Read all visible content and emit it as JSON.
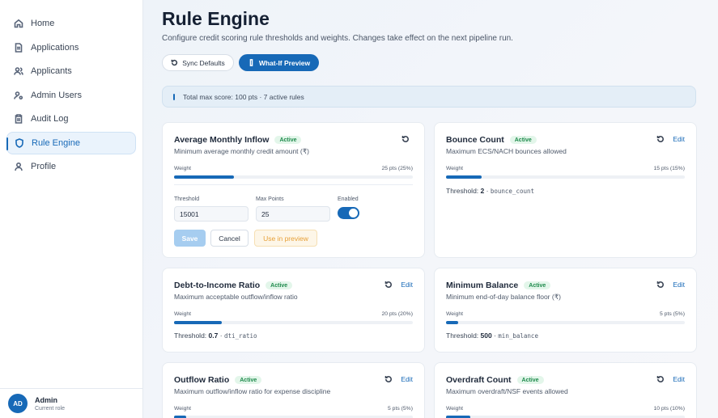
{
  "sidebar": {
    "items": [
      {
        "label": "Home",
        "icon": "home-icon"
      },
      {
        "label": "Applications",
        "icon": "document-icon"
      },
      {
        "label": "Applicants",
        "icon": "users-icon"
      },
      {
        "label": "Admin Users",
        "icon": "user-gear-icon"
      },
      {
        "label": "Audit Log",
        "icon": "clipboard-icon"
      },
      {
        "label": "Rule Engine",
        "icon": "shield-icon",
        "active": true
      },
      {
        "label": "Profile",
        "icon": "user-icon"
      }
    ],
    "user": {
      "initials": "AD",
      "name": "Admin",
      "role": "Current role"
    }
  },
  "header": {
    "title": "Rule Engine",
    "subtitle": "Configure credit scoring rule thresholds and weights. Changes take effect on the next pipeline run.",
    "sync_label": "Sync Defaults",
    "whatif_label": "What-If Preview"
  },
  "info": {
    "text": "Total max score: 100 pts · 7 active rules"
  },
  "colors": {
    "accent": "#1769b7",
    "active_badge": "#1f8a4c",
    "preview": "#e7a038"
  },
  "rules": [
    {
      "name": "Average Monthly Inflow",
      "status": "Active",
      "description": "Minimum average monthly credit amount (₹)",
      "weight_label": "Weight",
      "weight_text": "25 pts (25%)",
      "weight_pct": 25,
      "editing": true,
      "edit": {
        "threshold_label": "Threshold",
        "threshold_value": "15001",
        "max_points_label": "Max Points",
        "max_points_value": "25",
        "enabled_label": "Enabled",
        "enabled": true,
        "save_label": "Save",
        "cancel_label": "Cancel",
        "preview_label": "Use in preview"
      }
    },
    {
      "name": "Bounce Count",
      "status": "Active",
      "description": "Maximum ECS/NACH bounces allowed",
      "weight_label": "Weight",
      "weight_text": "15 pts (15%)",
      "weight_pct": 15,
      "threshold_label": "Threshold:",
      "threshold_value": "2",
      "threshold_key": "bounce_count",
      "edit_label": "Edit"
    },
    {
      "name": "Debt-to-Income Ratio",
      "status": "Active",
      "description": "Maximum acceptable outflow/inflow ratio",
      "weight_label": "Weight",
      "weight_text": "20 pts (20%)",
      "weight_pct": 20,
      "threshold_label": "Threshold:",
      "threshold_value": "0.7",
      "threshold_key": "dti_ratio",
      "edit_label": "Edit"
    },
    {
      "name": "Minimum Balance",
      "status": "Active",
      "description": "Minimum end-of-day balance floor (₹)",
      "weight_label": "Weight",
      "weight_text": "5 pts (5%)",
      "weight_pct": 5,
      "threshold_label": "Threshold:",
      "threshold_value": "500",
      "threshold_key": "min_balance",
      "edit_label": "Edit"
    },
    {
      "name": "Outflow Ratio",
      "status": "Active",
      "description": "Maximum outflow/inflow ratio for expense discipline",
      "weight_label": "Weight",
      "weight_text": "5 pts (5%)",
      "weight_pct": 5,
      "edit_label": "Edit"
    },
    {
      "name": "Overdraft Count",
      "status": "Active",
      "description": "Maximum overdraft/NSF events allowed",
      "weight_label": "Weight",
      "weight_text": "10 pts (10%)",
      "weight_pct": 10,
      "edit_label": "Edit"
    }
  ]
}
